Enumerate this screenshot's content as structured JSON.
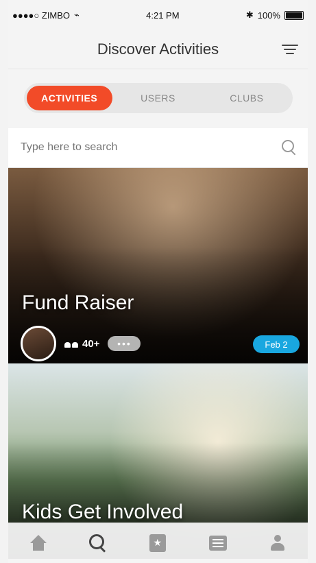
{
  "status_bar": {
    "carrier": "●●●●○ ZIMBO",
    "time": "4:21 PM",
    "battery": "100%"
  },
  "header": {
    "title": "Discover Activities"
  },
  "segment": {
    "tabs": [
      {
        "label": "ACTIVITIES"
      },
      {
        "label": "USERS"
      },
      {
        "label": "CLUBS"
      }
    ]
  },
  "search": {
    "placeholder": "Type here to search"
  },
  "cards": [
    {
      "title": "Fund Raiser",
      "members": "40+",
      "more_label": "•••",
      "date": "Feb 2"
    },
    {
      "title": "Kids Get Involved"
    }
  ],
  "tabbar": {
    "items": [
      {
        "icon": "home-icon"
      },
      {
        "icon": "search-icon"
      },
      {
        "icon": "star-icon"
      },
      {
        "icon": "chat-icon"
      },
      {
        "icon": "user-icon"
      }
    ]
  },
  "colors": {
    "accent": "#f24b28",
    "date_badge": "#19a7e0"
  }
}
